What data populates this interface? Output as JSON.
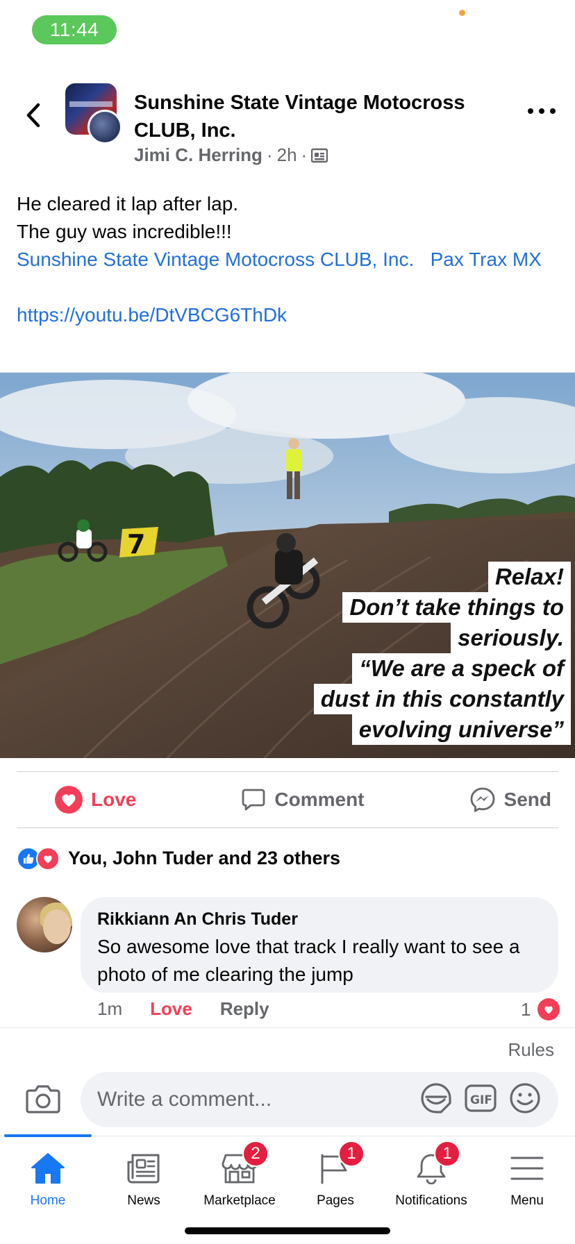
{
  "status_bar": {
    "time": "11:44"
  },
  "header": {
    "group_name": "Sunshine State Vintage Motocross CLUB, Inc.",
    "author": "Jimi C. Herring",
    "time_ago": "2h",
    "separator": "·",
    "icons": {
      "back": "back-arrow-icon",
      "audience": "group-audience-icon",
      "more": "more-options-icon"
    }
  },
  "post": {
    "lines": [
      "He cleared it lap after lap.",
      "The guy was incredible!!!"
    ],
    "tags": [
      "Sunshine State Vintage Motocross CLUB, Inc.",
      "Pax Trax MX"
    ],
    "url": "https://youtu.be/DtVBCG6ThDk",
    "image_caption_lines": [
      "Relax!",
      "Don’t take things to",
      "seriously.",
      "“We are a speck of",
      "dust in this constantly",
      "evolving universe”"
    ],
    "image_sign_number": "7"
  },
  "actions": {
    "love": "Love",
    "comment": "Comment",
    "send": "Send"
  },
  "reactions": {
    "summary": "You, John Tuder and 23 others"
  },
  "comment": {
    "author": "Rikkiann An Chris Tuder",
    "text": "So awesome love that track I really want to see a photo of me clearing the jump",
    "time": "1m",
    "love_label": "Love",
    "reply_label": "Reply",
    "reaction_count": "1"
  },
  "composer": {
    "rules_label": "Rules",
    "placeholder": "Write a comment..."
  },
  "tabs": [
    {
      "label": "Home",
      "icon": "home-icon",
      "badge": ""
    },
    {
      "label": "News",
      "icon": "news-icon",
      "badge": ""
    },
    {
      "label": "Marketplace",
      "icon": "marketplace-icon",
      "badge": "2"
    },
    {
      "label": "Pages",
      "icon": "pages-flag-icon",
      "badge": "1"
    },
    {
      "label": "Notifications",
      "icon": "bell-icon",
      "badge": "1"
    },
    {
      "label": "Menu",
      "icon": "menu-icon",
      "badge": ""
    }
  ],
  "colors": {
    "accent_blue": "#1877f2",
    "link_blue": "#216fdb",
    "love_red": "#f33e58",
    "badge_red": "#e41e3f",
    "status_green": "#5ac85a",
    "secondary_text": "#65676b"
  }
}
